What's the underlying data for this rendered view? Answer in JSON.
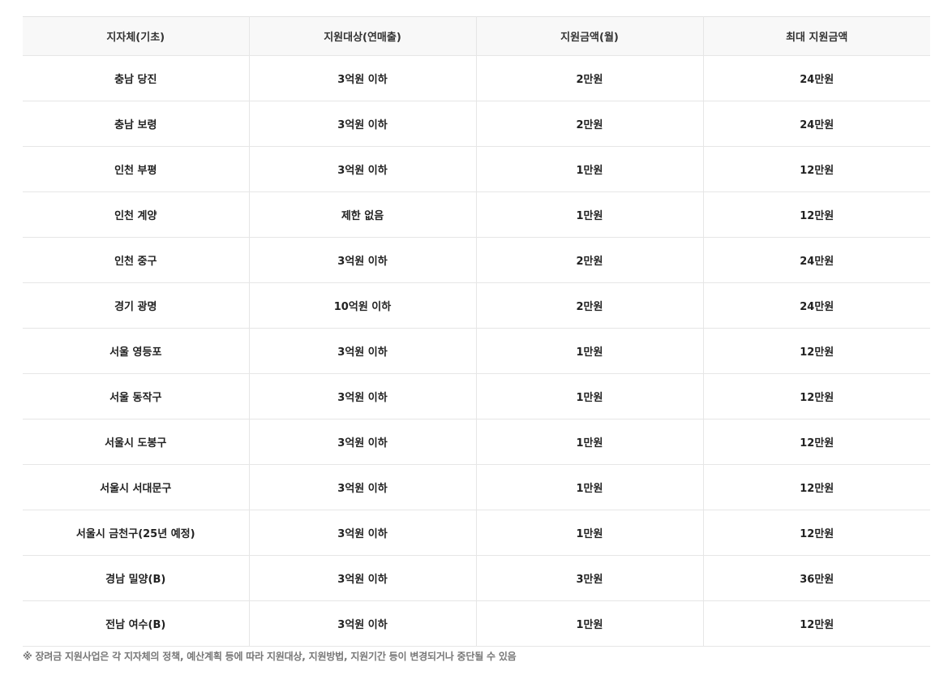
{
  "table": {
    "headers": [
      "지자체(기초)",
      "지원대상(연매출)",
      "지원금액(월)",
      "최대 지원금액"
    ],
    "rows": [
      [
        "충남 당진",
        "3억원 이하",
        "2만원",
        "24만원"
      ],
      [
        "충남 보령",
        "3억원 이하",
        "2만원",
        "24만원"
      ],
      [
        "인천 부평",
        "3억원 이하",
        "1만원",
        "12만원"
      ],
      [
        "인천 계양",
        "제한 없음",
        "1만원",
        "12만원"
      ],
      [
        "인천 중구",
        "3억원 이하",
        "2만원",
        "24만원"
      ],
      [
        "경기 광명",
        "10억원 이하",
        "2만원",
        "24만원"
      ],
      [
        "서울 영등포",
        "3억원 이하",
        "1만원",
        "12만원"
      ],
      [
        "서울 동작구",
        "3억원 이하",
        "1만원",
        "12만원"
      ],
      [
        "서울시 도봉구",
        "3억원 이하",
        "1만원",
        "12만원"
      ],
      [
        "서울시 서대문구",
        "3억원 이하",
        "1만원",
        "12만원"
      ],
      [
        "서울시 금천구(25년 예정)",
        "3억원 이하",
        "1만원",
        "12만원"
      ],
      [
        "경남 밀양(B)",
        "3억원 이하",
        "3만원",
        "36만원"
      ],
      [
        "전남 여수(B)",
        "3억원 이하",
        "1만원",
        "12만원"
      ]
    ]
  },
  "footnote": "※ 장려금 지원사업은 각 지자체의 정책, 예산계획 등에 따라 지원대상, 지원방법, 지원기간 등이 변경되거나 중단될 수 있음"
}
